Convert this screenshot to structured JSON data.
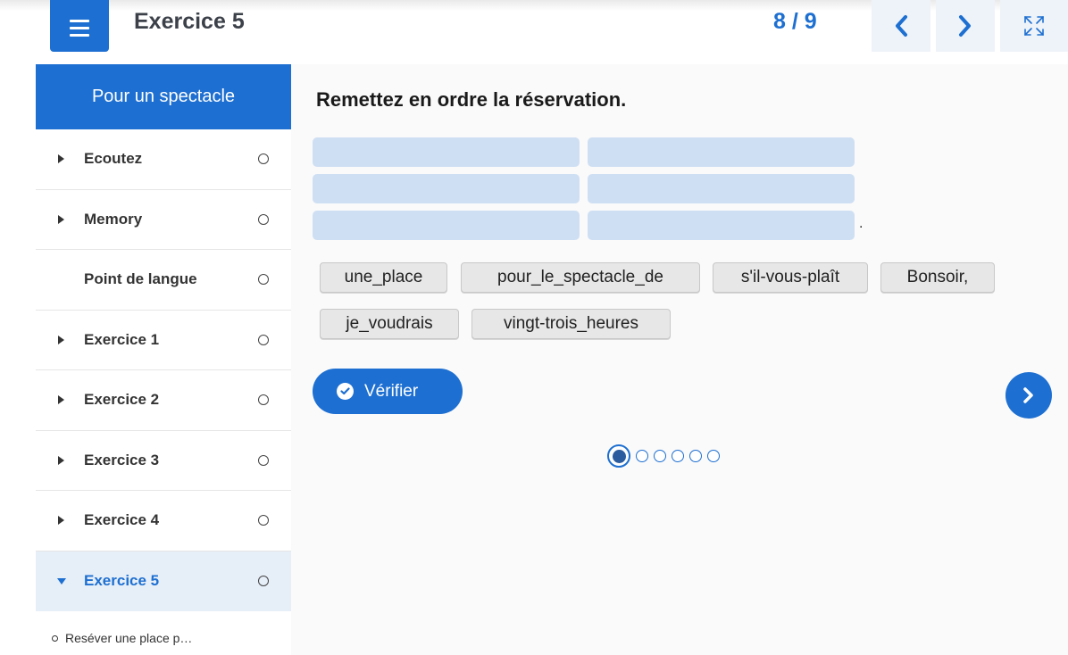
{
  "header": {
    "title": "Exercice 5",
    "page_counter": "8 / 9",
    "menu_icon": "hamburger-icon",
    "prev_icon": "chevron-left-icon",
    "next_icon": "chevron-right-icon",
    "fullscreen_icon": "fullscreen-icon",
    "accent_color": "#1d6fd1"
  },
  "sidebar": {
    "header": "Pour un spectacle",
    "items": [
      {
        "label": "Ecoutez",
        "expandable": true
      },
      {
        "label": "Memory",
        "expandable": true
      },
      {
        "label": "Point de langue",
        "expandable": false
      },
      {
        "label": "Exercice 1",
        "expandable": true
      },
      {
        "label": "Exercice 2",
        "expandable": true
      },
      {
        "label": "Exercice 3",
        "expandable": true
      },
      {
        "label": "Exercice 4",
        "expandable": true
      },
      {
        "label": "Exercice 5",
        "expandable": true,
        "active": true
      }
    ],
    "subitem": "Reséver une place p…"
  },
  "main": {
    "instruction": "Remettez en ordre la réservation.",
    "period": ".",
    "chips": [
      "une_place",
      "pour_le_spectacle_de",
      "s'il-vous-plaît",
      "Bonsoir,",
      "je_voudrais",
      "vingt-trois_heures"
    ],
    "verify_label": "Vérifier",
    "pager": {
      "total": 6,
      "current": 1
    }
  }
}
